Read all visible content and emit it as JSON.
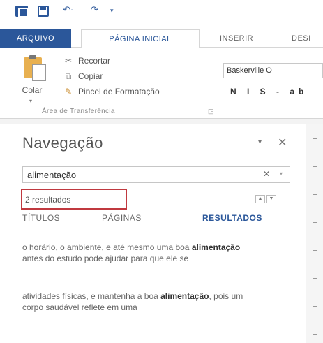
{
  "ribbon": {
    "tabs": [
      "ARQUIVO",
      "PÁGINA INICIAL",
      "INSERIR",
      "DESI"
    ],
    "clipboard": {
      "paste_label": "Colar",
      "cut_label": "Recortar",
      "copy_label": "Copiar",
      "format_painter_label": "Pincel de Formatação",
      "group_label": "Área de Transferência"
    },
    "font_name": "Baskerville O",
    "format_buttons": "N I S - ab"
  },
  "navigation": {
    "title": "Navegação",
    "search_value": "alimentação",
    "results_count": "2 resultados",
    "tabs": [
      "TÍTULOS",
      "PÁGINAS",
      "RESULTADOS"
    ],
    "results": [
      {
        "before": "o horário, o ambiente, e até mesmo uma boa ",
        "match": "alimentação",
        "after": " antes do estudo pode ajudar para que ele se"
      },
      {
        "before": "atividades físicas, e mantenha a boa ",
        "match": "alimentação",
        "after": ", pois um corpo saudável reflete em uma"
      }
    ]
  }
}
